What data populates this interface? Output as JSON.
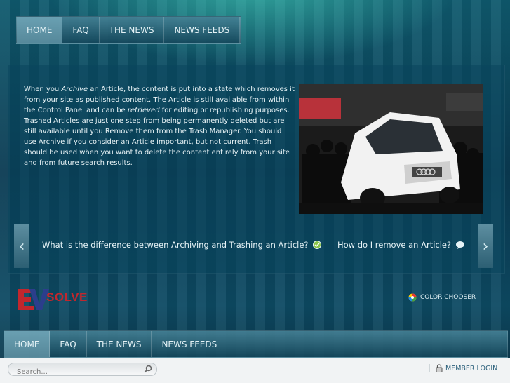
{
  "nav": {
    "items": [
      "HOME",
      "FAQ",
      "THE NEWS",
      "NEWS FEEDS"
    ]
  },
  "article": {
    "part1": "When you ",
    "archive": "Archive",
    "part2": " an Article, the content is put into a state which removes it from your site as published content. The Article is still available from within the Control Panel and can be ",
    "retrieved": "retrieved",
    "part3": " for editing or republishing purposes. Trashed Articles are just one step from being permanently deleted but are still available until you Remove them from the Trash Manager. You should use Archive if you consider an Article important, but not current. Trash should be used when you want to delete the content entirely from your site and from future search results."
  },
  "slider": {
    "prev_icon": "chevron-left-icon",
    "next_icon": "chevron-right-icon",
    "links": [
      "What is the difference between Archiving and Trashing an Article?",
      "How do I remove an Article?"
    ]
  },
  "logo": {
    "text": "SOLVE"
  },
  "color_chooser": {
    "label": "COLOR CHOOSER"
  },
  "search": {
    "placeholder": "Search..."
  },
  "member": {
    "label": "MEMBER LOGIN"
  },
  "colors": {
    "accent": "#2a5f7a",
    "nav_active": "#8cbecd"
  }
}
